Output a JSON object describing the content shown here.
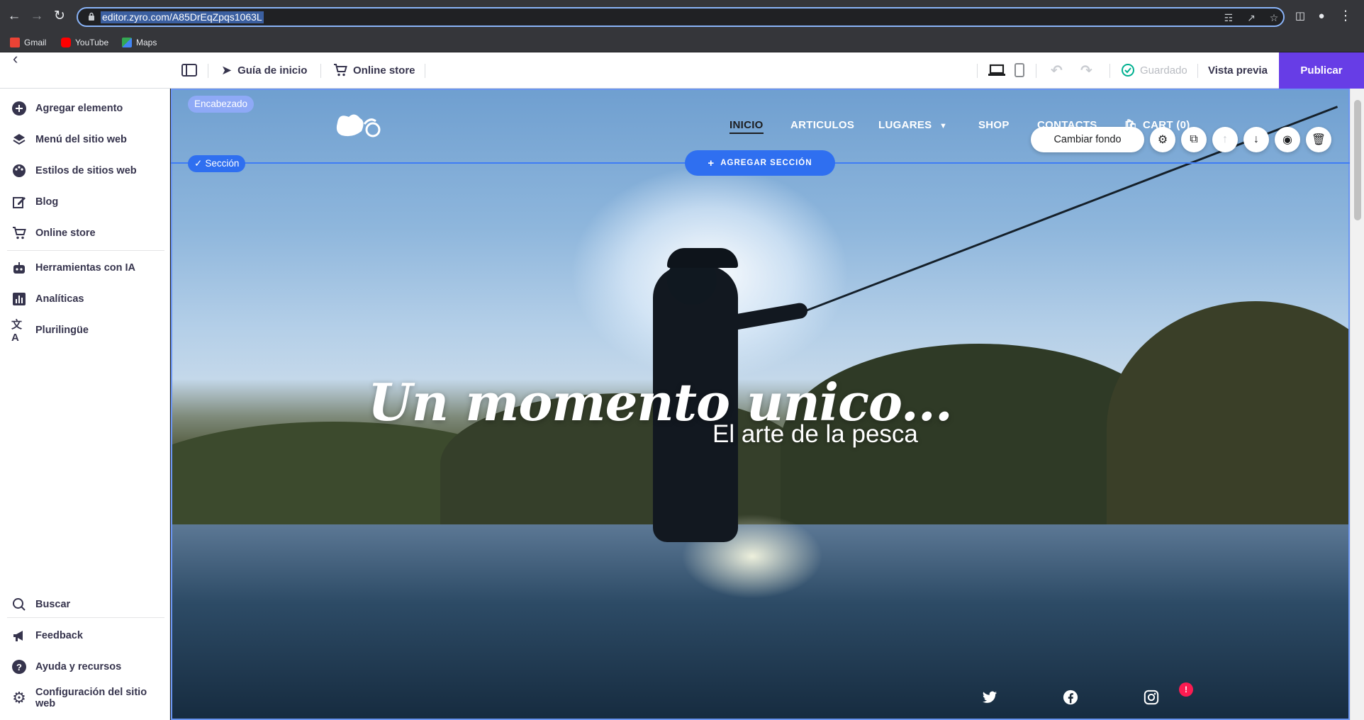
{
  "browser": {
    "url": "editor.zyro.com/A85DrEqZpqs1063L",
    "bookmarks": [
      "Gmail",
      "YouTube",
      "Maps"
    ]
  },
  "topbar": {
    "guide_label": "Guía de inicio",
    "store_label": "Online store",
    "saved_label": "Guardado",
    "preview_label": "Vista previa",
    "publish_label": "Publicar"
  },
  "sidebar": {
    "items": [
      {
        "label": "Agregar elemento",
        "icon": "plus-circle-icon"
      },
      {
        "label": "Menú del sitio web",
        "icon": "layers-icon"
      },
      {
        "label": "Estilos de sitios web",
        "icon": "palette-icon"
      },
      {
        "label": "Blog",
        "icon": "edit-icon"
      },
      {
        "label": "Online store",
        "icon": "cart-icon"
      },
      {
        "label": "Herramientas con IA",
        "icon": "robot-icon"
      },
      {
        "label": "Analíticas",
        "icon": "chart-icon"
      },
      {
        "label": "Plurilingüe",
        "icon": "translate-icon"
      }
    ],
    "bottom": [
      {
        "label": "Buscar",
        "icon": "search-icon"
      },
      {
        "label": "Feedback",
        "icon": "megaphone-icon"
      },
      {
        "label": "Ayuda y recursos",
        "icon": "help-icon"
      },
      {
        "label": "Configuración del sitio web",
        "icon": "gear-icon"
      }
    ]
  },
  "canvas": {
    "header_label": "Encabezado",
    "section_label": "Sección",
    "add_section_label": "AGREGAR SECCIÓN",
    "change_bg_label": "Cambiar fondo",
    "nav": [
      "INICIO",
      "ARTICULOS",
      "LUGARES",
      "SHOP",
      "CONTACTS",
      "CART (0)"
    ],
    "hero_title": "Un momento unico...",
    "hero_subtitle": "El arte de la pesca",
    "notification_badge": "!"
  },
  "colors": {
    "accent": "#673de6",
    "selection_blue": "#2f6ff0",
    "header_tag": "#8ea9f6",
    "badge_red": "#fc1b51"
  }
}
